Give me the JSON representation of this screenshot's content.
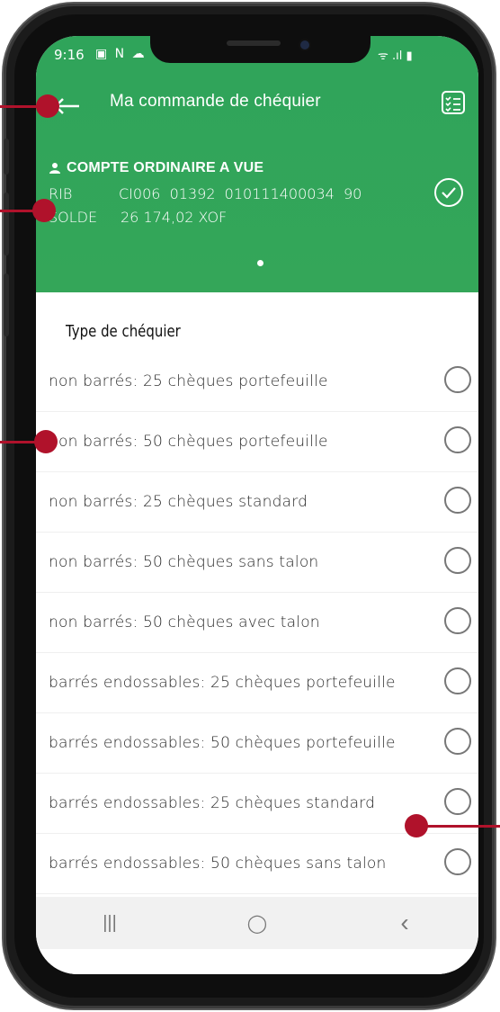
{
  "status_bar": {
    "time": "9:16",
    "left_icons": "▣ N ☁",
    "right_icons": "ᯤ .ıl ▮"
  },
  "header": {
    "title": "Ma commande de chéquier"
  },
  "account": {
    "name": "COMPTE ORDINAIRE A VUE",
    "rib_label": "RIB",
    "rib_value": "CI006  01392  010111400034  90",
    "solde_label": "SOLDE",
    "solde_value": "26 174,02 XOF"
  },
  "section": {
    "title": "Type de chéquier"
  },
  "options": [
    {
      "label": "non barrés: 25 chèques portefeuille"
    },
    {
      "label": "non barrés: 50 chèques portefeuille"
    },
    {
      "label": "non barrés: 25 chèques standard"
    },
    {
      "label": "non barrés: 50 chèques sans talon"
    },
    {
      "label": "non barrés: 50 chèques avec talon"
    },
    {
      "label": "barrés endossables: 25 chèques portefeuille"
    },
    {
      "label": "barrés endossables: 50 chèques portefeuille"
    },
    {
      "label": "barrés endossables: 25 chèques standard"
    },
    {
      "label": "barrés endossables: 50 chèques sans talon"
    }
  ],
  "navbar": {
    "recents": "|||",
    "home": "◯",
    "back": "‹"
  },
  "colors": {
    "header_green": "#34a659",
    "callout_red": "#b0122b"
  }
}
